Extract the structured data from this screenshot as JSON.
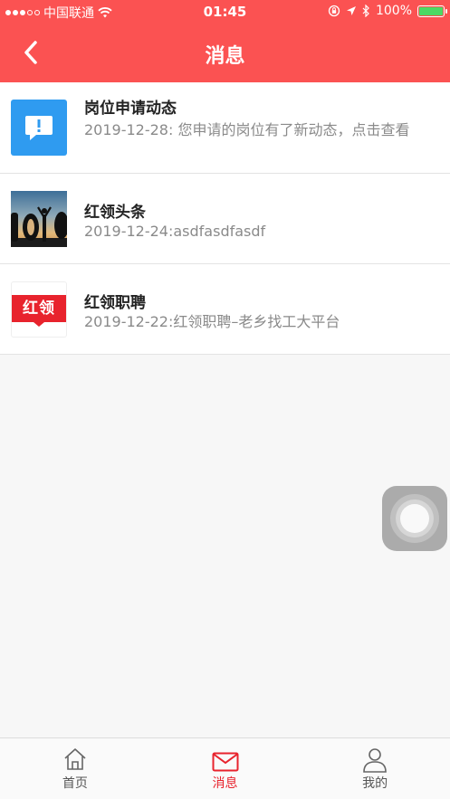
{
  "status_bar": {
    "carrier": "中国联通",
    "time": "01:45",
    "battery": "100%"
  },
  "header": {
    "title": "消息"
  },
  "messages": [
    {
      "title": "岗位申请动态",
      "subtitle": "2019-12-28: 您申请的岗位有了新动态，点击查看"
    },
    {
      "title": "红领头条",
      "subtitle": "2019-12-24:asdfasdfasdf"
    },
    {
      "title": "红领职聘",
      "subtitle": "2019-12-22:红领职聘–老乡找工大平台"
    }
  ],
  "logo_text": "红领",
  "tabs": [
    {
      "label": "首页"
    },
    {
      "label": "消息"
    },
    {
      "label": "我的"
    }
  ],
  "colors": {
    "brand_red": "#fb5252",
    "active_tab": "#e8232d",
    "info_blue": "#2f9bf0"
  }
}
